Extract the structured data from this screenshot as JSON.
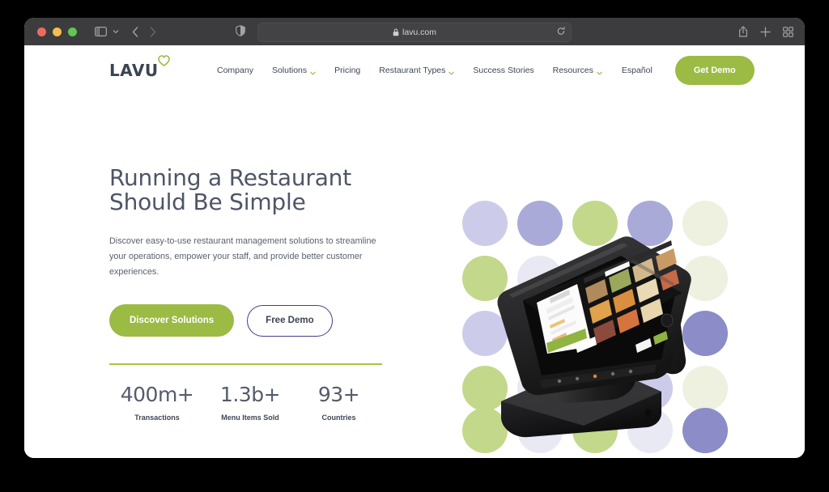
{
  "browser": {
    "url": "lavu.com",
    "icons": {
      "traffic_close": "close-window-dot",
      "traffic_minimize": "minimize-window-dot",
      "traffic_zoom": "zoom-window-dot",
      "sidebar": "sidebar-toggle-icon",
      "sidebar_caret": "chevron-down-icon",
      "back": "back-arrow-icon",
      "forward": "forward-arrow-icon",
      "shield": "privacy-shield-icon",
      "lock": "lock-icon",
      "reload": "reload-icon",
      "share": "share-icon",
      "new_tab": "plus-icon",
      "tab_overview": "tab-grid-icon"
    }
  },
  "site": {
    "logo": {
      "word": "LAVU",
      "mark": "heart-icon"
    },
    "nav": [
      {
        "label": "Company",
        "has_dropdown": false
      },
      {
        "label": "Solutions",
        "has_dropdown": true
      },
      {
        "label": "Pricing",
        "has_dropdown": false
      },
      {
        "label": "Restaurant Types",
        "has_dropdown": true
      },
      {
        "label": "Success Stories",
        "has_dropdown": false
      },
      {
        "label": "Resources",
        "has_dropdown": true
      }
    ],
    "language_label": "Español",
    "demo_button": "Get Demo"
  },
  "hero": {
    "headline": "Running a Restaurant\nShould Be Simple",
    "subtext": "Discover easy-to-use restaurant management solutions to streamline your operations, empower your staff, and provide better customer experiences.",
    "primary_cta": "Discover Solutions",
    "secondary_cta": "Free Demo",
    "stats": [
      {
        "value": "400m+",
        "label": "Transactions"
      },
      {
        "value": "1.3b+",
        "label": "Menu Items Sold"
      },
      {
        "value": "93+",
        "label": "Countries"
      }
    ],
    "image_alt": "pos-terminal-on-stand"
  },
  "colors": {
    "brand_green": "#9bbb45",
    "divider_green": "#a6c444",
    "heading_slate": "#4e5566",
    "outline_blue": "#3f3f8f",
    "dot_green": "#c3d88a",
    "dot_purple": "#8b8cc8",
    "dot_lavender": "#ccccea",
    "dot_cream": "#eef0e0",
    "dot_pale": "#e9e9f4",
    "titlebar": "#3c3c3e",
    "page_bg": "#ffffff",
    "desktop_bg": "#000000"
  }
}
